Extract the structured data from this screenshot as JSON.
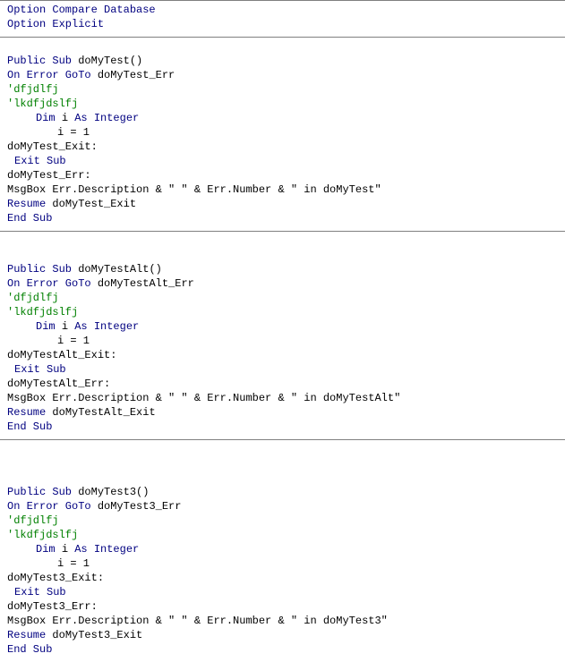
{
  "header": {
    "optionCompare": "Option Compare Database",
    "optionExplicit": "Option Explicit"
  },
  "colors": {
    "keyword": "#000080",
    "comment": "#008000",
    "text": "#000000",
    "separator": "#808080"
  },
  "procs": [
    {
      "kw_public_sub": "Public Sub",
      "name": "doMyTest",
      "parens": "()",
      "kw_on_error_goto": "On Error GoTo",
      "err_label": "doMyTest_Err",
      "comment1": "'dfjdlfj",
      "comment2": "'lkdfjdslfj",
      "kw_dim": "Dim",
      "var": "i",
      "kw_as": "As Integer",
      "assign": "i = 1",
      "exit_label": "doMyTest_Exit:",
      "kw_exit_sub": "Exit Sub",
      "err_label_line": "doMyTest_Err:",
      "msgbox_line": "MsgBox Err.Description & \" \" & Err.Number & \" in doMyTest\"",
      "kw_resume": "Resume",
      "resume_target": "doMyTest_Exit",
      "kw_end_sub": "End Sub"
    },
    {
      "kw_public_sub": "Public Sub",
      "name": "doMyTestAlt",
      "parens": "()",
      "kw_on_error_goto": "On Error GoTo",
      "err_label": "doMyTestAlt_Err",
      "comment1": "'dfjdlfj",
      "comment2": "'lkdfjdslfj",
      "kw_dim": "Dim",
      "var": "i",
      "kw_as": "As Integer",
      "assign": "i = 1",
      "exit_label": "doMyTestAlt_Exit:",
      "kw_exit_sub": "Exit Sub",
      "err_label_line": "doMyTestAlt_Err:",
      "msgbox_line": "MsgBox Err.Description & \" \" & Err.Number & \" in doMyTestAlt\"",
      "kw_resume": "Resume",
      "resume_target": "doMyTestAlt_Exit",
      "kw_end_sub": "End Sub"
    },
    {
      "kw_public_sub": "Public Sub",
      "name": "doMyTest3",
      "parens": "()",
      "kw_on_error_goto": "On Error GoTo",
      "err_label": "doMyTest3_Err",
      "comment1": "'dfjdlfj",
      "comment2": "'lkdfjdslfj",
      "kw_dim": "Dim",
      "var": "i",
      "kw_as": "As Integer",
      "assign": "i = 1",
      "exit_label": "doMyTest3_Exit:",
      "kw_exit_sub": "Exit Sub",
      "err_label_line": "doMyTest3_Err:",
      "msgbox_line": "MsgBox Err.Description & \" \" & Err.Number & \" in doMyTest3\"",
      "kw_resume": "Resume",
      "resume_target": "doMyTest3_Exit",
      "kw_end_sub": "End Sub"
    }
  ]
}
